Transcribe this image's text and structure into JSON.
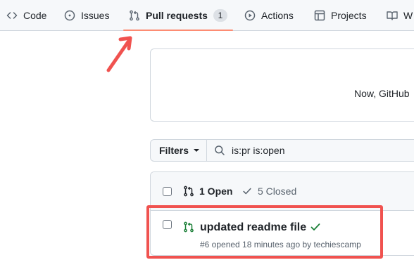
{
  "repo_nav": {
    "tabs": [
      {
        "label": "Code",
        "icon": "code-icon"
      },
      {
        "label": "Issues",
        "icon": "issue-opened-icon"
      },
      {
        "label": "Pull requests",
        "icon": "git-pull-request-icon",
        "count": "1",
        "selected": true
      },
      {
        "label": "Actions",
        "icon": "play-icon"
      },
      {
        "label": "Projects",
        "icon": "table-icon"
      },
      {
        "label": "W",
        "icon": "book-icon"
      }
    ]
  },
  "banner": {
    "text": "Now, GitHub"
  },
  "filters": {
    "button_label": "Filters",
    "search_value": "is:pr is:open"
  },
  "list": {
    "open_label": "1 Open",
    "closed_label": "5 Closed",
    "items": [
      {
        "title": "updated readme file",
        "meta": "#6 opened 18 minutes ago by techiescamp"
      }
    ]
  },
  "colors": {
    "accent_underline": "#fd8c73",
    "annotation_red": "#f0524f",
    "open_green": "#1a7f37",
    "border": "#d0d7de"
  }
}
